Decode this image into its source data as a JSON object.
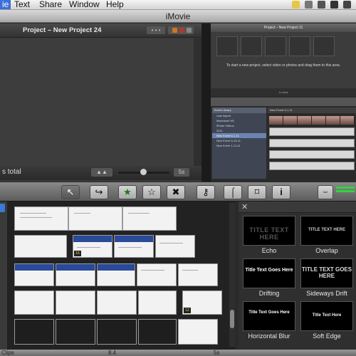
{
  "menubar": {
    "items": [
      "ie",
      "Text",
      "Share",
      "Window",
      "Help"
    ]
  },
  "window": {
    "title": "iMovie"
  },
  "project": {
    "title": "Project – New Project 24",
    "footer_text": "s total",
    "duration_label": "5s"
  },
  "viewer": {
    "header": "Project – New Project 11",
    "empty_message": "To start a new project, select video or photos and drag them to this area.",
    "footer": "1s total",
    "event_library": {
      "header": "Event Library",
      "rows": [
        "Last Import",
        "Macintosh HD",
        "iPhoto Videos",
        "2011",
        "New Event 5-1-11",
        "New Event 5-15-11",
        "New Event 1-11-11"
      ],
      "selected_index": 4
    },
    "event_header": "New Event 5-1-11"
  },
  "toolbar": {
    "buttons": [
      {
        "name": "select-arrow-icon",
        "glyph": "↖"
      },
      {
        "name": "add-to-project-icon",
        "glyph": "↪"
      },
      {
        "name": "favorite-star-icon",
        "glyph": "★"
      },
      {
        "name": "unmark-star-icon",
        "glyph": "☆"
      },
      {
        "name": "reject-icon",
        "glyph": "✖"
      },
      {
        "name": "keyword-icon",
        "glyph": "⚷"
      },
      {
        "name": "voiceover-mic-icon",
        "glyph": "⌠"
      },
      {
        "name": "crop-icon",
        "glyph": "⌑"
      },
      {
        "name": "inspector-info-icon",
        "glyph": "i"
      }
    ]
  },
  "browser": {
    "badge1": "16",
    "badge2": "12"
  },
  "titles": {
    "items": [
      {
        "caption": "Echo",
        "preview": "TITLE TEXT HERE"
      },
      {
        "caption": "Overlap",
        "preview": "TITLE TEXT HERE"
      },
      {
        "caption": "Drifting",
        "preview": "Title Text Goes Here"
      },
      {
        "caption": "Sideways Drift",
        "preview": "TITLE TEXT GOES HERE"
      },
      {
        "caption": "Horizontal Blur",
        "preview": "Title Text Goes Here"
      },
      {
        "caption": "Soft Edge",
        "preview": "Title Text Here"
      }
    ]
  },
  "bottombar": {
    "left": "Clips",
    "mid": "8.4",
    "right": "5s"
  },
  "colors": {
    "accent_green": "#38d040",
    "selection_blue": "#3a6fd8"
  }
}
